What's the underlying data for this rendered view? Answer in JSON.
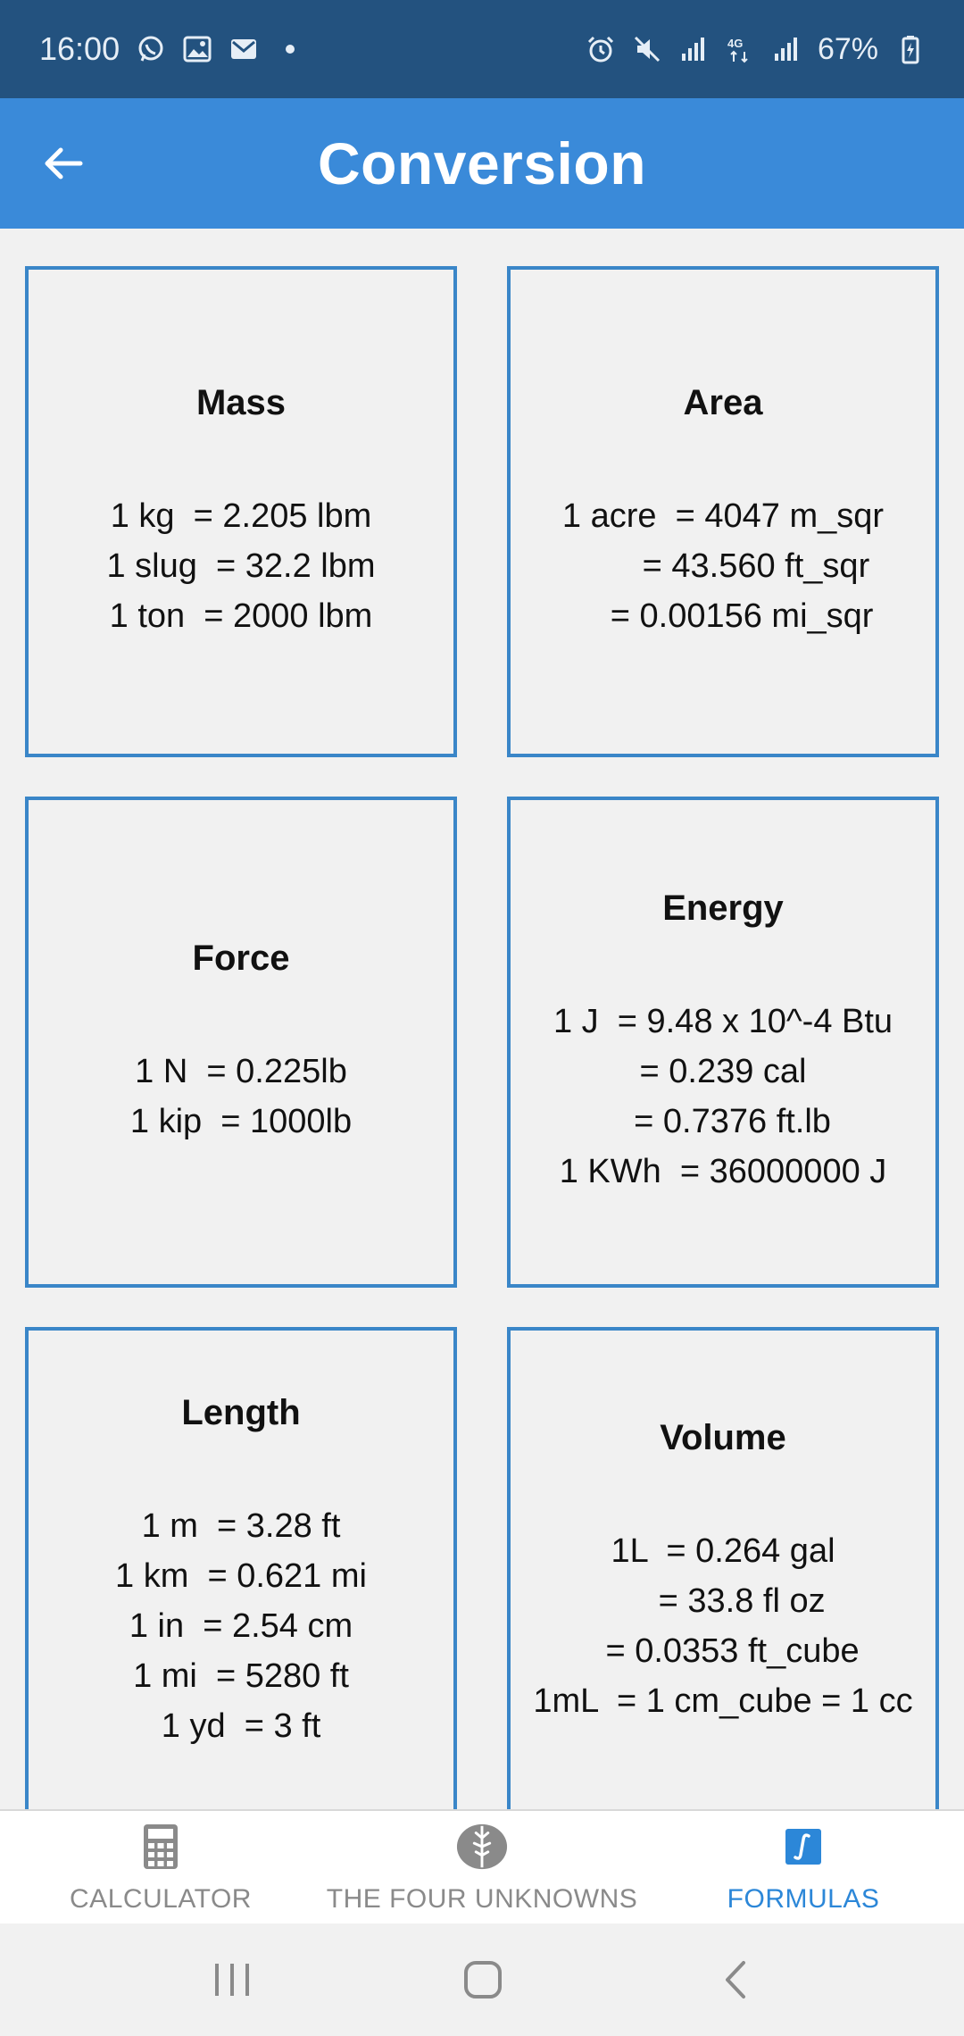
{
  "status_bar": {
    "time": "16:00",
    "battery_percent": "67%",
    "left_icons": [
      "whatsapp-icon",
      "gallery-icon",
      "mail-icon"
    ],
    "right_icons": [
      "alarm-icon",
      "mute-icon",
      "signal-icon",
      "4g-icon",
      "signal-icon",
      "battery-charging-icon"
    ]
  },
  "app_bar": {
    "title": "Conversion",
    "back_icon": "arrow-left-icon"
  },
  "cards": [
    {
      "title": "Mass",
      "lines": [
        "1 kg  = 2.205 lbm",
        "1 slug  = 32.2 lbm",
        "1 ton  = 2000 lbm"
      ]
    },
    {
      "title": "Area",
      "lines": [
        "1 acre  = 4047 m_sqr",
        "       = 43.560 ft_sqr",
        "    = 0.00156 mi_sqr"
      ]
    },
    {
      "title": "Force",
      "lines": [
        "1 N  = 0.225lb",
        "1 kip  = 1000lb"
      ]
    },
    {
      "title": "Energy",
      "lines": [
        "1 J  = 9.48 x 10^-4 Btu",
        "= 0.239 cal",
        "  = 0.7376 ft.lb",
        "1 KWh  = 36000000 J"
      ]
    },
    {
      "title": "Length",
      "lines": [
        "1 m  = 3.28 ft",
        "1 km  = 0.621 mi",
        "1 in  = 2.54 cm",
        "1 mi  = 5280 ft",
        "1 yd  = 3 ft"
      ]
    },
    {
      "title": "Volume",
      "lines": [
        "1L  = 0.264 gal",
        "    = 33.8 fl oz",
        "  = 0.0353 ft_cube",
        "1mL  = 1 cm_cube = 1 cc"
      ]
    }
  ],
  "bottom_nav": {
    "items": [
      {
        "label": "CALCULATOR",
        "icon": "calculator-icon",
        "active": false
      },
      {
        "label": "THE FOUR UNKNOWNS",
        "icon": "brain-icon",
        "active": false
      },
      {
        "label": "FORMULAS",
        "icon": "integral-icon",
        "active": true
      }
    ],
    "active_color": "#2c87d8",
    "inactive_color": "#8a8a8a"
  },
  "system_nav": {
    "buttons": [
      "recents-icon",
      "home-icon",
      "back-icon"
    ]
  },
  "colors": {
    "status_bar": "#23527f",
    "app_bar": "#3a8ad9",
    "card_border": "#3a86c8",
    "background": "#f1f1f1"
  }
}
